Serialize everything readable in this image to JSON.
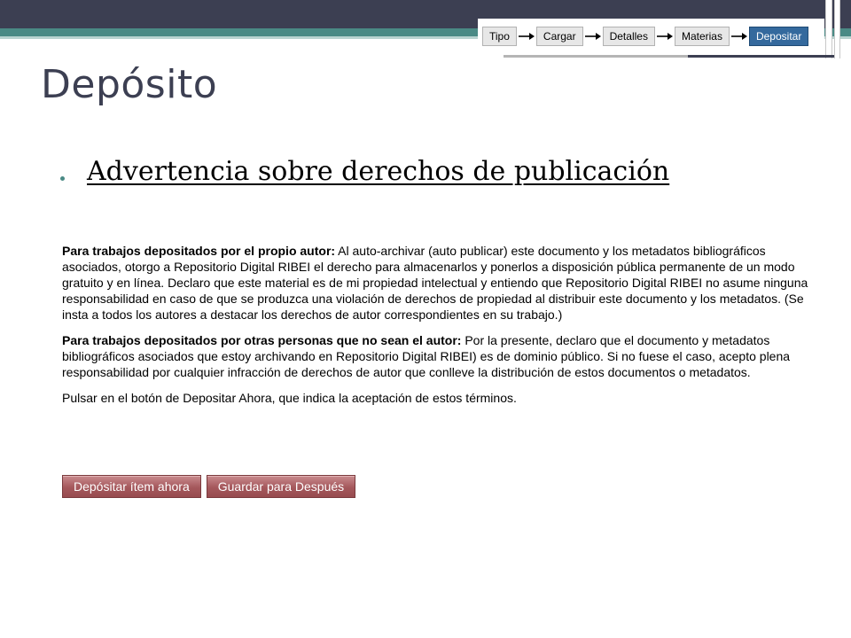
{
  "progress": {
    "steps": [
      {
        "label": "Tipo"
      },
      {
        "label": "Cargar"
      },
      {
        "label": "Detalles"
      },
      {
        "label": "Materias"
      },
      {
        "label": "Depositar"
      }
    ],
    "active_step": "Depositar"
  },
  "slide": {
    "title": "Depósito",
    "bullet_link": "Advertencia sobre derechos de publicación"
  },
  "license": {
    "p1_bold": "Para trabajos depositados por el propio autor:",
    "p1_text": " Al auto-archivar (auto publicar) este documento y los metadatos bibliográficos asociados, otorgo a Repositorio Digital RIBEI el derecho para almacenarlos y ponerlos a disposición pública permanente de un modo gratuito y en línea. Declaro que este material es de mi propiedad intelectual y entiendo que Repositorio Digital RIBEI no asume ninguna responsabilidad en caso de que se produzca una violación de derechos de propiedad al distribuir este documento y los metadatos. (Se insta a todos los autores a destacar los derechos de autor correspondientes en su trabajo.)",
    "p2_bold": "Para trabajos depositados por otras personas que no sean el autor:",
    "p2_text": " Por la presente, declaro que el documento y metadatos bibliográficos asociados que estoy archivando en Repositorio Digital RIBEI) es de dominio público. Si no fuese el caso, acepto plena responsabilidad por cualquier infracción de derechos de autor que conlleve la distribución de estos documentos o metadatos.",
    "p3_text": "Pulsar en el botón de Depositar Ahora, que indica la aceptación de estos términos."
  },
  "buttons": {
    "deposit": "Depósitar ítem ahora",
    "save_later": "Guardar para Después"
  },
  "colors": {
    "title": "#3c3f52",
    "accent_teal": "#4a8a85",
    "active_step": "#34699d",
    "button": "#a5585c"
  },
  "icons": [
    "arrow-right-icon",
    "bullet-icon"
  ]
}
